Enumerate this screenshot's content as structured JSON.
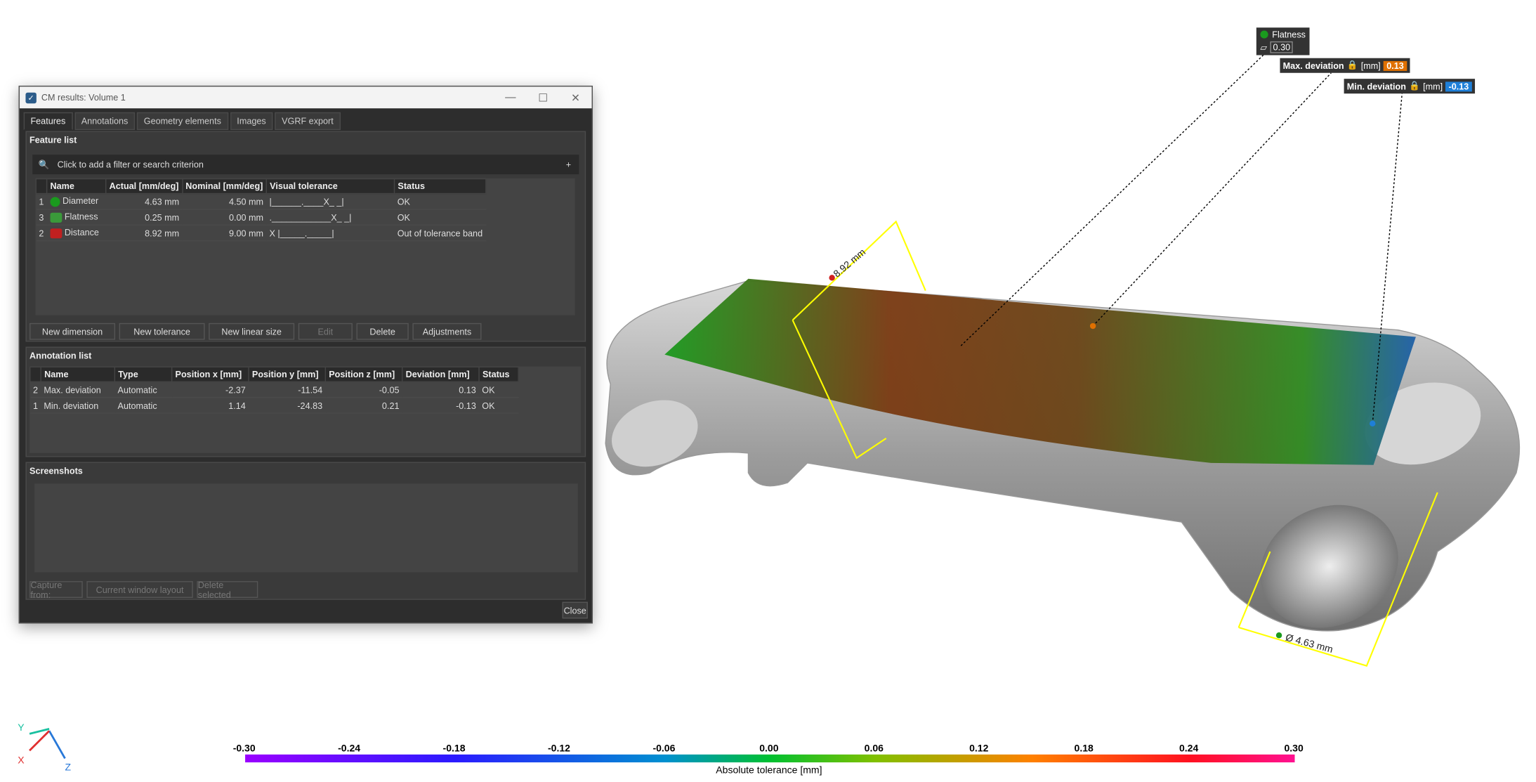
{
  "window": {
    "title": "CM results: Volume 1",
    "close_label": "Close"
  },
  "tabs": [
    {
      "label": "Features"
    },
    {
      "label": "Annotations"
    },
    {
      "label": "Geometry elements"
    },
    {
      "label": "Images"
    },
    {
      "label": "VGRF export"
    }
  ],
  "feature_list": {
    "title": "Feature list",
    "search_placeholder": "Click to add a filter or search criterion",
    "plus": "+",
    "headers": [
      "Name",
      "Actual [mm/deg]",
      "Nominal [mm/deg]",
      "Visual tolerance",
      "Status"
    ],
    "rows": [
      {
        "index": "1",
        "name": "Diameter",
        "actual": "4.63 mm",
        "nominal": "4.50 mm",
        "visual": "|______.____X_ _|",
        "status": "OK",
        "icon": "diameter-icon"
      },
      {
        "index": "3",
        "name": "Flatness",
        "actual": "0.25 mm",
        "nominal": "0.00 mm",
        "visual": ".____________X_ _|",
        "status": "OK",
        "icon": "flatness-icon"
      },
      {
        "index": "2",
        "name": "Distance",
        "actual": "8.92 mm",
        "nominal": "9.00 mm",
        "visual": "X     |_____._____|",
        "status": "Out of tolerance band",
        "icon": "distance-icon"
      }
    ],
    "buttons": {
      "new_dimension": "New dimension",
      "new_tolerance": "New tolerance",
      "new_linear_size": "New linear size",
      "edit": "Edit",
      "delete": "Delete",
      "adjustments": "Adjustments"
    }
  },
  "annotation_list": {
    "title": "Annotation list",
    "headers": [
      "Name",
      "Type",
      "Position x [mm]",
      "Position y [mm]",
      "Position z [mm]",
      "Deviation [mm]",
      "Status"
    ],
    "rows": [
      {
        "index": "2",
        "name": "Max. deviation",
        "type": "Automatic",
        "x": "-2.37",
        "y": "-11.54",
        "z": "-0.05",
        "dev": "0.13",
        "status": "OK"
      },
      {
        "index": "1",
        "name": "Min. deviation",
        "type": "Automatic",
        "x": "1.14",
        "y": "-24.83",
        "z": "0.21",
        "dev": "-0.13",
        "status": "OK"
      }
    ]
  },
  "screenshots": {
    "title": "Screenshots",
    "capture_from": "Capture from:",
    "layout": "Current window layout",
    "delete_selected": "Delete selected"
  },
  "viewport": {
    "flatness_label": "Flatness",
    "flatness_value": "0.30",
    "max_dev_label": "Max. deviation",
    "max_dev_unit": "[mm]",
    "max_dev_value": "0.13",
    "min_dev_label": "Min. deviation",
    "min_dev_unit": "[mm]",
    "min_dev_value": "-0.13",
    "distance_dim": "8.92 mm",
    "diameter_dim": "Ø 4.63 mm",
    "axis_y": "Y",
    "axis_x": "X",
    "axis_z": "Z"
  },
  "color_scale": {
    "ticks": [
      "-0.30",
      "-0.24",
      "-0.18",
      "-0.12",
      "-0.06",
      "0.00",
      "0.06",
      "0.12",
      "0.18",
      "0.24",
      "0.30"
    ],
    "label": "Absolute tolerance [mm]"
  },
  "colors": {
    "max_dev": "#e07000",
    "min_dev": "#1e7fd8",
    "dark_panel": "#2d2d2d"
  }
}
